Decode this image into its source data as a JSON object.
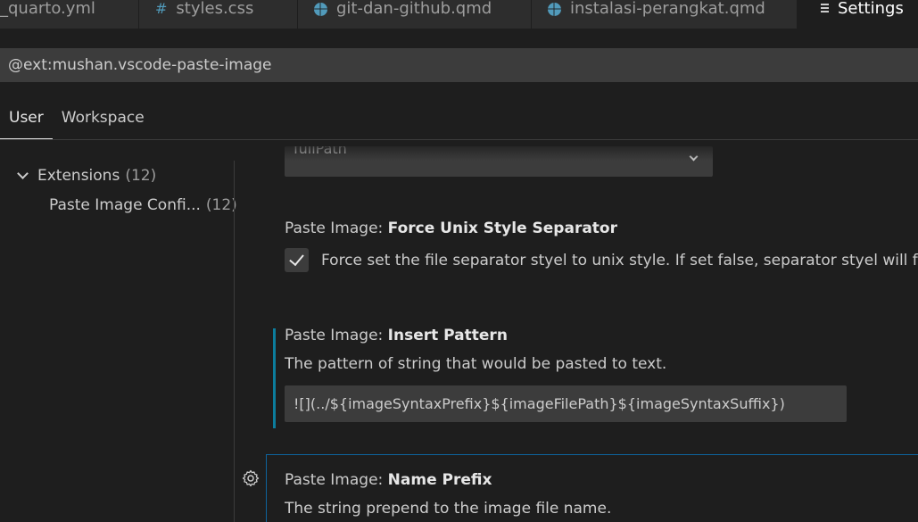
{
  "tabs": [
    {
      "label": "_quarto.yml",
      "icon": "yaml-file-icon"
    },
    {
      "label": "styles.css",
      "icon": "hash-icon"
    },
    {
      "label": "git-dan-github.qmd",
      "icon": "quarto-globe-icon"
    },
    {
      "label": "instalasi-perangkat.qmd",
      "icon": "quarto-globe-icon"
    },
    {
      "label": "Settings",
      "icon": "settings-lines-icon",
      "active": true
    }
  ],
  "tab_icon_glyph": "#",
  "search": {
    "value": "@ext:mushan.vscode-paste-image"
  },
  "scope_tabs": [
    "User",
    "Workspace"
  ],
  "toc": {
    "group": {
      "label": "Extensions",
      "count": "(12)"
    },
    "child": {
      "label": "Paste Image Confi...",
      "count": "(12)"
    }
  },
  "settings": {
    "path_select": {
      "value": "fullPath"
    },
    "force_unix": {
      "category": "Paste Image: ",
      "key": "Force Unix Style Separator",
      "checked": true,
      "description": "Force set the file separator styel to unix style. If set false, separator styel will fo"
    },
    "insert_pattern": {
      "category": "Paste Image: ",
      "key": "Insert Pattern",
      "description": "The pattern of string that would be pasted to text.",
      "value": "![](../${imageSyntaxPrefix}${imageFilePath}${imageSyntaxSuffix})"
    },
    "name_prefix": {
      "category": "Paste Image: ",
      "key": "Name Prefix",
      "description": "The string prepend to the image file name."
    }
  },
  "colors": {
    "accent": "#0e639c",
    "modified": "#0c7d9d",
    "background": "#1e1e1e"
  }
}
